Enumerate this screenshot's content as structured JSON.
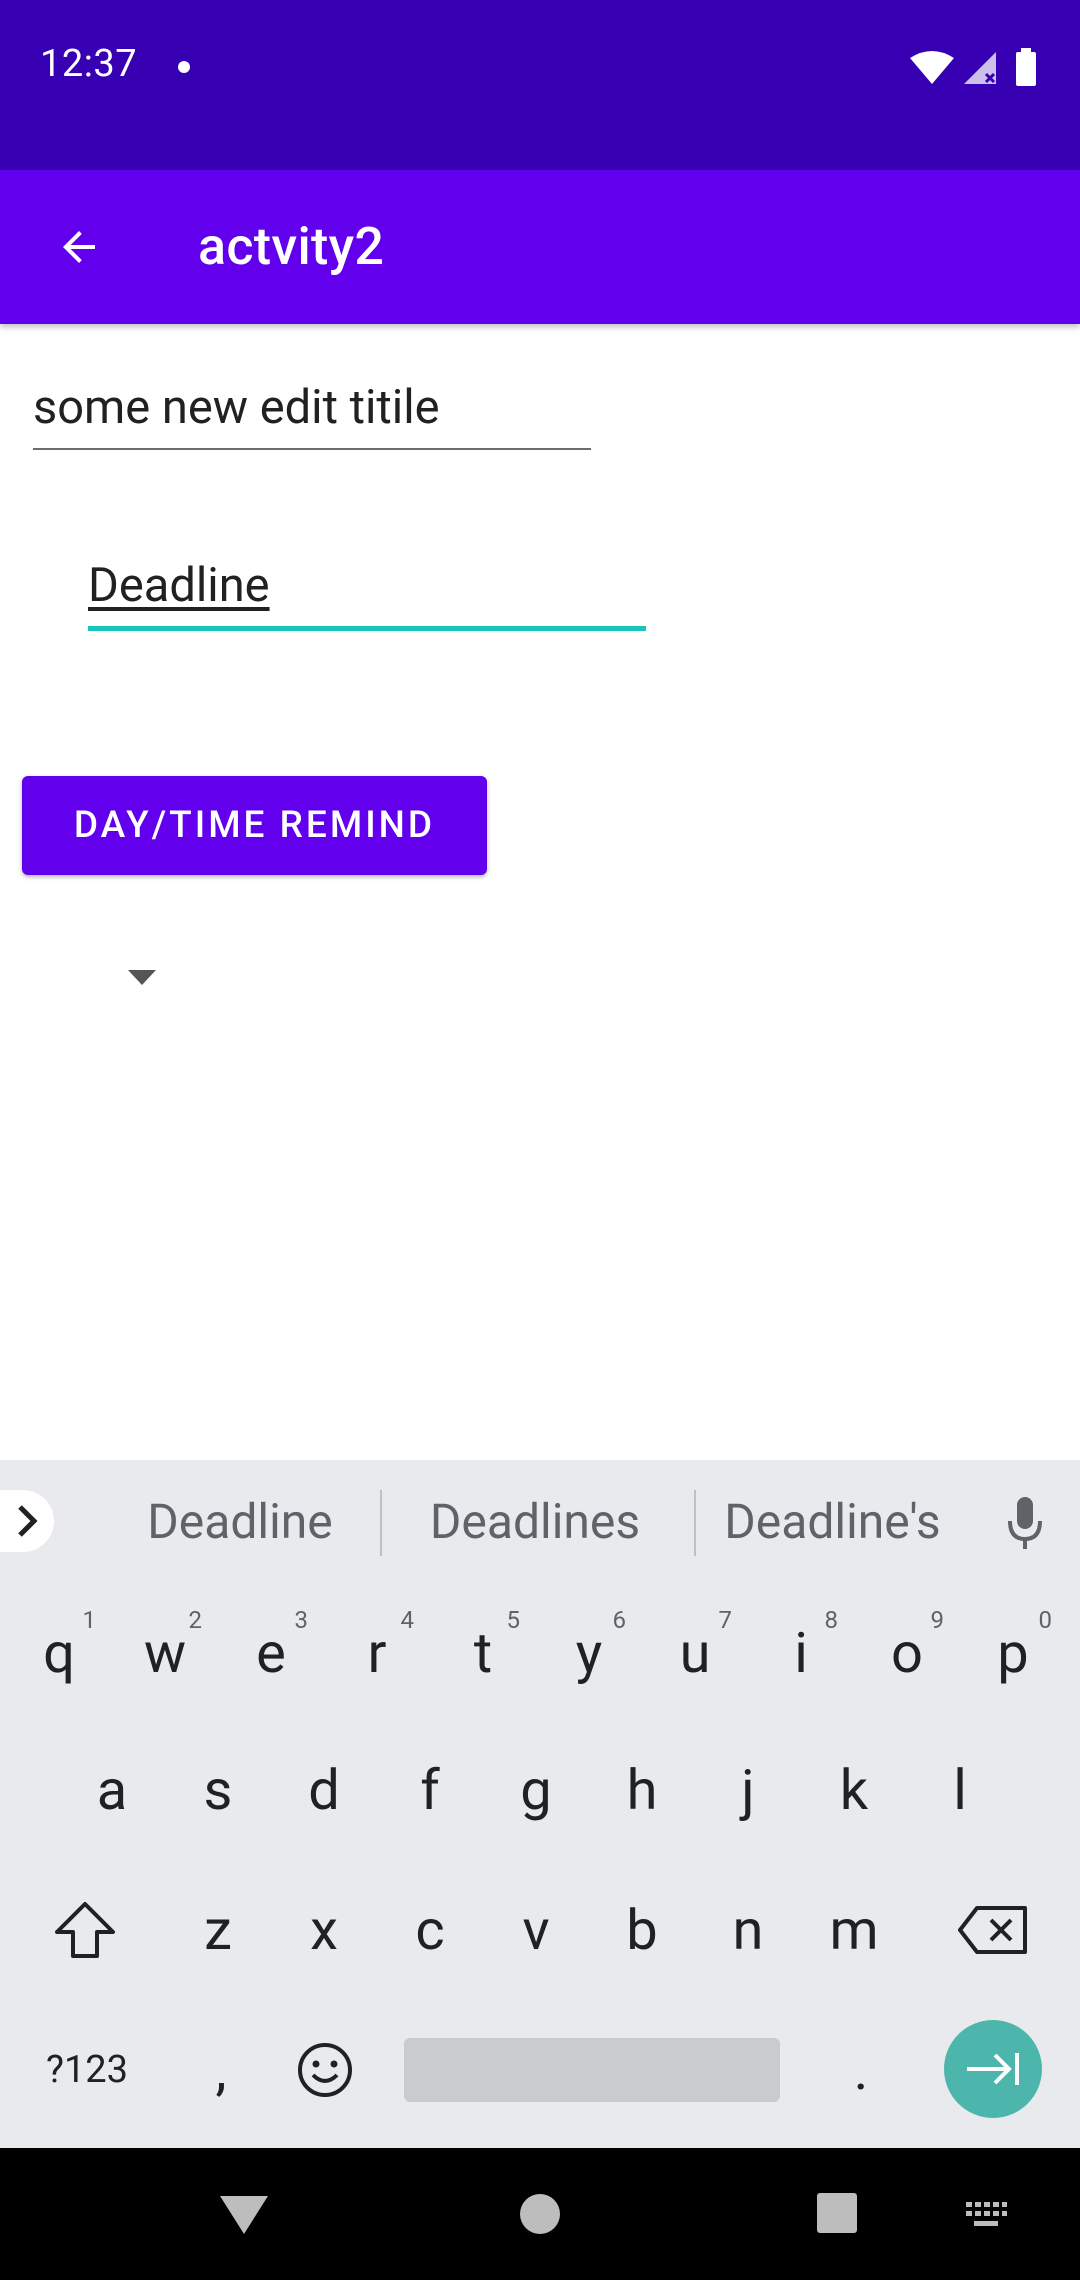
{
  "status_bar": {
    "time": "12:37",
    "bg_color": "#3700B3",
    "icons": [
      "notification-dot-icon",
      "wifi-icon",
      "signal-icon",
      "battery-icon"
    ]
  },
  "app_bar": {
    "title": "actvity2",
    "back_icon": "arrow-back-icon",
    "bg_color": "#6200EE"
  },
  "form": {
    "title_value": "some new edit titile",
    "deadline_value": "Deadline",
    "remind_button_label": "DAY/TIME REMIND",
    "focused_underline_color": "#18c5b8"
  },
  "keyboard": {
    "suggestions": [
      "Deadline",
      "Deadlines",
      "Deadline's"
    ],
    "row1": [
      {
        "key": "q",
        "hint": "1"
      },
      {
        "key": "w",
        "hint": "2"
      },
      {
        "key": "e",
        "hint": "3"
      },
      {
        "key": "r",
        "hint": "4"
      },
      {
        "key": "t",
        "hint": "5"
      },
      {
        "key": "y",
        "hint": "6"
      },
      {
        "key": "u",
        "hint": "7"
      },
      {
        "key": "i",
        "hint": "8"
      },
      {
        "key": "o",
        "hint": "9"
      },
      {
        "key": "p",
        "hint": "0"
      }
    ],
    "row2": [
      "a",
      "s",
      "d",
      "f",
      "g",
      "h",
      "j",
      "k",
      "l"
    ],
    "row3": [
      "z",
      "x",
      "c",
      "v",
      "b",
      "n",
      "m"
    ],
    "symbols_label": "?123",
    "comma": ",",
    "period": ".",
    "enter_color": "#4DB6AC"
  },
  "nav_bar": {
    "icons": [
      "back-triangle-icon",
      "home-circle-icon",
      "recents-square-icon",
      "keyboard-switch-icon"
    ]
  }
}
